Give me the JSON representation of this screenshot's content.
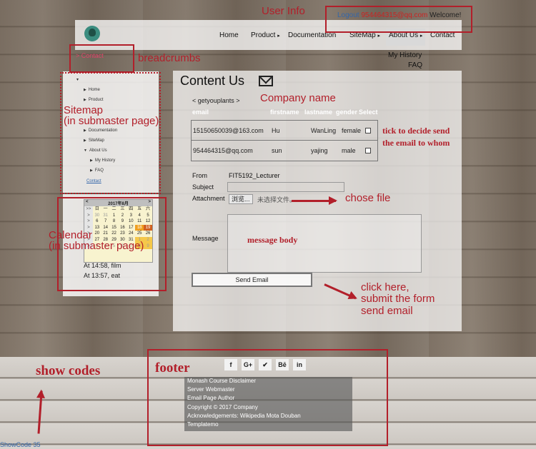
{
  "user": {
    "logout": "Logout",
    "email": "954464315@qq.com",
    "welcome": "Welcome!"
  },
  "nav": {
    "items": [
      "Home",
      "Product",
      "Documentation",
      "SiteMap",
      "About Us",
      "Contact"
    ],
    "arrows": [
      "▸"
    ],
    "dropdown": [
      "My History",
      "FAQ"
    ]
  },
  "breadcrumb": "> Contact",
  "sitemap": {
    "items": [
      "Home",
      "Product",
      "Documentation",
      "SiteMap",
      "About Us",
      "My History",
      "FAQ",
      "Contact"
    ]
  },
  "calendar": {
    "header_prev": "<",
    "header_title": "2017年8月",
    "header_next": ">",
    "weekdays": [
      "日",
      "一",
      "二",
      "三",
      "四",
      "五",
      "六"
    ],
    "rows": [
      [
        "30",
        "31",
        "1",
        "2",
        "3",
        "4",
        "5"
      ],
      [
        "6",
        "7",
        "8",
        "9",
        "10",
        "11",
        "12"
      ],
      [
        "13",
        "14",
        "15",
        "16",
        "17",
        "18",
        "19"
      ],
      [
        "20",
        "21",
        "22",
        "23",
        "24",
        "25",
        "26"
      ],
      [
        "27",
        "28",
        "29",
        "30",
        "31",
        "1",
        "2"
      ],
      [
        "3",
        "4",
        "5",
        "6",
        "7",
        "8",
        "9"
      ]
    ],
    "corner": ">>",
    "side": ">"
  },
  "events": [
    "At 14:58, film",
    "At 13:57, eat"
  ],
  "main": {
    "title": "Content Us",
    "company": "< getyouplants >",
    "table_headers": [
      "email",
      "firstname",
      "lastname",
      "gender",
      "Select"
    ],
    "rows": [
      {
        "email": "15150650039@163.com",
        "firstname": "Hu",
        "lastname": "WanLing",
        "gender": "female"
      },
      {
        "email": "954464315@qq.com",
        "firstname": "sun",
        "lastname": "yajing",
        "gender": "male"
      }
    ],
    "from_label": "From",
    "from_value": "FIT5192_Lecturer",
    "subject_label": "Subject",
    "attachment_label": "Attachment",
    "file_button": "浏览...",
    "file_status": "未选择文件。",
    "message_label": "Message",
    "send_label": "Send Email"
  },
  "annotations": {
    "user_info": "User Info",
    "breadcrumbs": "breadcrumbs",
    "company_name": "Company name",
    "sitemap_line1": "Sitemap",
    "sitemap_line2": "(in submaster page)",
    "tick": "tick to decide send",
    "tick2": "the email to whom",
    "chose_file": "chose file",
    "message_body": "message body",
    "calendar_line1": "Calendar",
    "calendar_line2": "(in submaster page)",
    "click1": "click here,",
    "click2": "submit the form",
    "click3": "send email",
    "show_codes": "show codes",
    "footer": "footer"
  },
  "social": [
    "f",
    "G+",
    "✔",
    "Bē",
    "in"
  ],
  "footer_lines": [
    "Monash Course Disclaimer",
    "Server Webmaster",
    "Email Page Author",
    "Copyright © 2017 Company",
    "Acknowledgements: Wikipedia   Mota   Douban",
    "Templatemo"
  ],
  "showcode": "ShowCode 35",
  "colors": {
    "annotation": "#b21f2a",
    "accent": "#3b8c7f",
    "crumb": "#e0446a",
    "link": "#3366aa"
  }
}
